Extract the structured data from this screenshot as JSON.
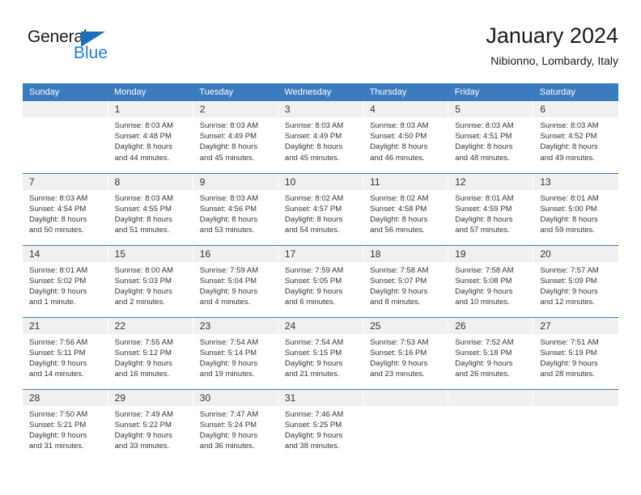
{
  "brand": {
    "name_top": "General",
    "name_bottom": "Blue",
    "accent_color": "#1c7fd6",
    "triangle_color": "#1c6fba"
  },
  "header": {
    "title": "January 2024",
    "location": "Nibionno, Lombardy, Italy"
  },
  "theme": {
    "header_row_bg": "#3a7cbe",
    "day_number_bg": "#f0f0f0",
    "text_color": "#333333"
  },
  "weekday_headers": [
    "Sunday",
    "Monday",
    "Tuesday",
    "Wednesday",
    "Thursday",
    "Friday",
    "Saturday"
  ],
  "weeks": [
    [
      {
        "day": "",
        "sunrise": "",
        "sunset": "",
        "daylight_1": "",
        "daylight_2": ""
      },
      {
        "day": "1",
        "sunrise": "Sunrise: 8:03 AM",
        "sunset": "Sunset: 4:48 PM",
        "daylight_1": "Daylight: 8 hours",
        "daylight_2": "and 44 minutes."
      },
      {
        "day": "2",
        "sunrise": "Sunrise: 8:03 AM",
        "sunset": "Sunset: 4:49 PM",
        "daylight_1": "Daylight: 8 hours",
        "daylight_2": "and 45 minutes."
      },
      {
        "day": "3",
        "sunrise": "Sunrise: 8:03 AM",
        "sunset": "Sunset: 4:49 PM",
        "daylight_1": "Daylight: 8 hours",
        "daylight_2": "and 45 minutes."
      },
      {
        "day": "4",
        "sunrise": "Sunrise: 8:03 AM",
        "sunset": "Sunset: 4:50 PM",
        "daylight_1": "Daylight: 8 hours",
        "daylight_2": "and 46 minutes."
      },
      {
        "day": "5",
        "sunrise": "Sunrise: 8:03 AM",
        "sunset": "Sunset: 4:51 PM",
        "daylight_1": "Daylight: 8 hours",
        "daylight_2": "and 48 minutes."
      },
      {
        "day": "6",
        "sunrise": "Sunrise: 8:03 AM",
        "sunset": "Sunset: 4:52 PM",
        "daylight_1": "Daylight: 8 hours",
        "daylight_2": "and 49 minutes."
      }
    ],
    [
      {
        "day": "7",
        "sunrise": "Sunrise: 8:03 AM",
        "sunset": "Sunset: 4:54 PM",
        "daylight_1": "Daylight: 8 hours",
        "daylight_2": "and 50 minutes."
      },
      {
        "day": "8",
        "sunrise": "Sunrise: 8:03 AM",
        "sunset": "Sunset: 4:55 PM",
        "daylight_1": "Daylight: 8 hours",
        "daylight_2": "and 51 minutes."
      },
      {
        "day": "9",
        "sunrise": "Sunrise: 8:03 AM",
        "sunset": "Sunset: 4:56 PM",
        "daylight_1": "Daylight: 8 hours",
        "daylight_2": "and 53 minutes."
      },
      {
        "day": "10",
        "sunrise": "Sunrise: 8:02 AM",
        "sunset": "Sunset: 4:57 PM",
        "daylight_1": "Daylight: 8 hours",
        "daylight_2": "and 54 minutes."
      },
      {
        "day": "11",
        "sunrise": "Sunrise: 8:02 AM",
        "sunset": "Sunset: 4:58 PM",
        "daylight_1": "Daylight: 8 hours",
        "daylight_2": "and 56 minutes."
      },
      {
        "day": "12",
        "sunrise": "Sunrise: 8:01 AM",
        "sunset": "Sunset: 4:59 PM",
        "daylight_1": "Daylight: 8 hours",
        "daylight_2": "and 57 minutes."
      },
      {
        "day": "13",
        "sunrise": "Sunrise: 8:01 AM",
        "sunset": "Sunset: 5:00 PM",
        "daylight_1": "Daylight: 8 hours",
        "daylight_2": "and 59 minutes."
      }
    ],
    [
      {
        "day": "14",
        "sunrise": "Sunrise: 8:01 AM",
        "sunset": "Sunset: 5:02 PM",
        "daylight_1": "Daylight: 9 hours",
        "daylight_2": "and 1 minute."
      },
      {
        "day": "15",
        "sunrise": "Sunrise: 8:00 AM",
        "sunset": "Sunset: 5:03 PM",
        "daylight_1": "Daylight: 9 hours",
        "daylight_2": "and 2 minutes."
      },
      {
        "day": "16",
        "sunrise": "Sunrise: 7:59 AM",
        "sunset": "Sunset: 5:04 PM",
        "daylight_1": "Daylight: 9 hours",
        "daylight_2": "and 4 minutes."
      },
      {
        "day": "17",
        "sunrise": "Sunrise: 7:59 AM",
        "sunset": "Sunset: 5:05 PM",
        "daylight_1": "Daylight: 9 hours",
        "daylight_2": "and 6 minutes."
      },
      {
        "day": "18",
        "sunrise": "Sunrise: 7:58 AM",
        "sunset": "Sunset: 5:07 PM",
        "daylight_1": "Daylight: 9 hours",
        "daylight_2": "and 8 minutes."
      },
      {
        "day": "19",
        "sunrise": "Sunrise: 7:58 AM",
        "sunset": "Sunset: 5:08 PM",
        "daylight_1": "Daylight: 9 hours",
        "daylight_2": "and 10 minutes."
      },
      {
        "day": "20",
        "sunrise": "Sunrise: 7:57 AM",
        "sunset": "Sunset: 5:09 PM",
        "daylight_1": "Daylight: 9 hours",
        "daylight_2": "and 12 minutes."
      }
    ],
    [
      {
        "day": "21",
        "sunrise": "Sunrise: 7:56 AM",
        "sunset": "Sunset: 5:11 PM",
        "daylight_1": "Daylight: 9 hours",
        "daylight_2": "and 14 minutes."
      },
      {
        "day": "22",
        "sunrise": "Sunrise: 7:55 AM",
        "sunset": "Sunset: 5:12 PM",
        "daylight_1": "Daylight: 9 hours",
        "daylight_2": "and 16 minutes."
      },
      {
        "day": "23",
        "sunrise": "Sunrise: 7:54 AM",
        "sunset": "Sunset: 5:14 PM",
        "daylight_1": "Daylight: 9 hours",
        "daylight_2": "and 19 minutes."
      },
      {
        "day": "24",
        "sunrise": "Sunrise: 7:54 AM",
        "sunset": "Sunset: 5:15 PM",
        "daylight_1": "Daylight: 9 hours",
        "daylight_2": "and 21 minutes."
      },
      {
        "day": "25",
        "sunrise": "Sunrise: 7:53 AM",
        "sunset": "Sunset: 5:16 PM",
        "daylight_1": "Daylight: 9 hours",
        "daylight_2": "and 23 minutes."
      },
      {
        "day": "26",
        "sunrise": "Sunrise: 7:52 AM",
        "sunset": "Sunset: 5:18 PM",
        "daylight_1": "Daylight: 9 hours",
        "daylight_2": "and 26 minutes."
      },
      {
        "day": "27",
        "sunrise": "Sunrise: 7:51 AM",
        "sunset": "Sunset: 5:19 PM",
        "daylight_1": "Daylight: 9 hours",
        "daylight_2": "and 28 minutes."
      }
    ],
    [
      {
        "day": "28",
        "sunrise": "Sunrise: 7:50 AM",
        "sunset": "Sunset: 5:21 PM",
        "daylight_1": "Daylight: 9 hours",
        "daylight_2": "and 31 minutes."
      },
      {
        "day": "29",
        "sunrise": "Sunrise: 7:49 AM",
        "sunset": "Sunset: 5:22 PM",
        "daylight_1": "Daylight: 9 hours",
        "daylight_2": "and 33 minutes."
      },
      {
        "day": "30",
        "sunrise": "Sunrise: 7:47 AM",
        "sunset": "Sunset: 5:24 PM",
        "daylight_1": "Daylight: 9 hours",
        "daylight_2": "and 36 minutes."
      },
      {
        "day": "31",
        "sunrise": "Sunrise: 7:46 AM",
        "sunset": "Sunset: 5:25 PM",
        "daylight_1": "Daylight: 9 hours",
        "daylight_2": "and 38 minutes."
      },
      {
        "day": "",
        "sunrise": "",
        "sunset": "",
        "daylight_1": "",
        "daylight_2": ""
      },
      {
        "day": "",
        "sunrise": "",
        "sunset": "",
        "daylight_1": "",
        "daylight_2": ""
      },
      {
        "day": "",
        "sunrise": "",
        "sunset": "",
        "daylight_1": "",
        "daylight_2": ""
      }
    ]
  ]
}
